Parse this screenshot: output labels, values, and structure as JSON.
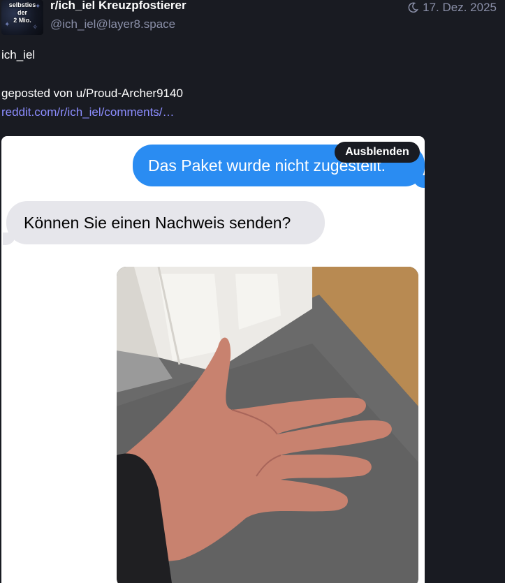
{
  "author": {
    "avatar_text": "selbsties\nder\n2 Mio.",
    "display_name": "r/ich_iel Kreuzpfostierer",
    "handle": "@ich_iel@layer8.space"
  },
  "post": {
    "timestamp": "17. Dez. 2025",
    "visibility_icon": "moon-icon",
    "body": "ich_iel",
    "posted_by": "geposted von u/Proud-Archer9140",
    "link_text": "reddit.com/r/ich_iel/comments/…"
  },
  "media": {
    "hide_label": "Ausblenden",
    "message_sent": "Das Paket wurde nicht zugestellt.",
    "message_received": "Können Sie einen Nachweis senden?"
  },
  "colors": {
    "background": "#191b22",
    "link": "#8c8dff",
    "muted": "#8a8fa8",
    "bubble_blue": "#2a8cf2",
    "bubble_gray": "#e6e6eb"
  }
}
